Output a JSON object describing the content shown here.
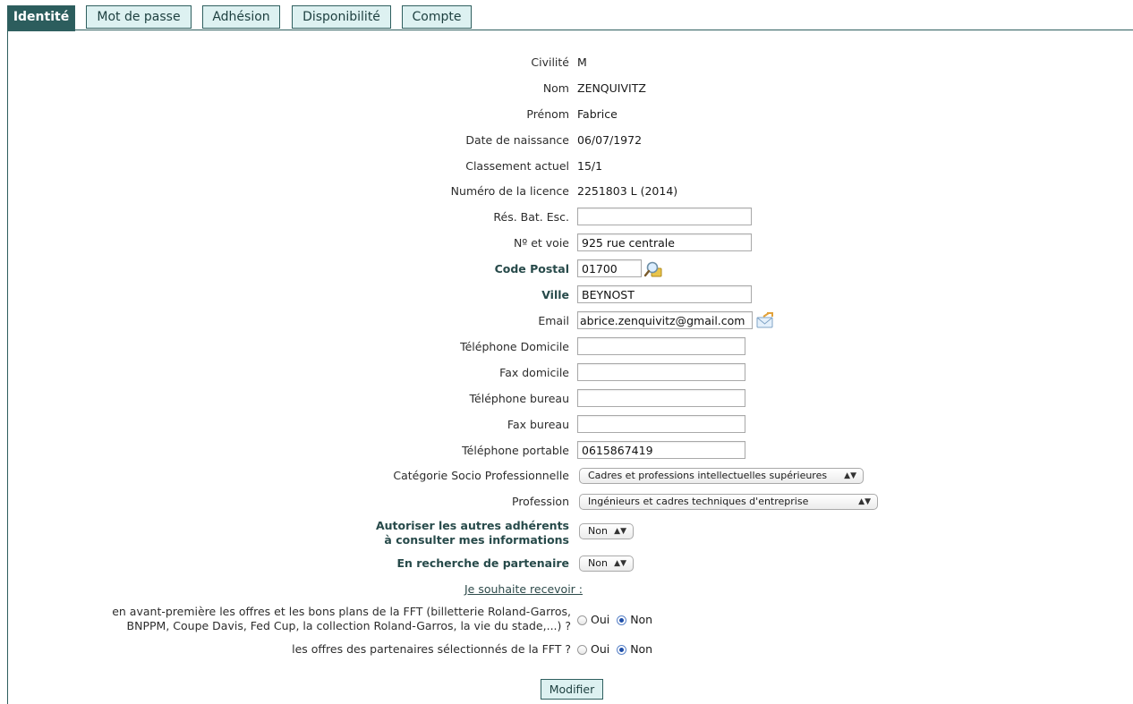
{
  "tabs": [
    "Identité",
    "Mot de passe",
    "Adhésion",
    "Disponibilité",
    "Compte"
  ],
  "fields": {
    "civilite": {
      "label": "Civilité",
      "value": "M"
    },
    "nom": {
      "label": "Nom",
      "value": "ZENQUIVITZ"
    },
    "prenom": {
      "label": "Prénom",
      "value": "Fabrice"
    },
    "naissance": {
      "label": "Date de naissance",
      "value": "06/07/1972"
    },
    "classement": {
      "label": "Classement actuel",
      "value": "15/1"
    },
    "licence": {
      "label": "Numéro de la licence",
      "value": "2251803 L (2014)"
    },
    "res": {
      "label": "Rés. Bat. Esc.",
      "value": ""
    },
    "voie": {
      "label": "Nº et voie",
      "value": "925 rue centrale"
    },
    "cp": {
      "label": "Code Postal",
      "value": "01700"
    },
    "ville": {
      "label": "Ville",
      "value": "BEYNOST"
    },
    "email": {
      "label": "Email",
      "value": "abrice.zenquivitz@gmail.com"
    },
    "tel_dom": {
      "label": "Téléphone Domicile",
      "value": ""
    },
    "fax_dom": {
      "label": "Fax domicile",
      "value": ""
    },
    "tel_bur": {
      "label": "Téléphone bureau",
      "value": ""
    },
    "fax_bur": {
      "label": "Fax bureau",
      "value": ""
    },
    "portable": {
      "label": "Téléphone portable",
      "value": "0615867419"
    },
    "csp": {
      "label": "Catégorie Socio Professionnelle",
      "value": "Cadres et professions intellectuelles supérieures"
    },
    "profession": {
      "label": "Profession",
      "value": "Ingénieurs et cadres techniques d'entreprise"
    },
    "autoriser": {
      "label_line1": "Autoriser les autres adhérents",
      "label_line2": "à consulter mes informations",
      "value": "Non"
    },
    "recherche": {
      "label": "En recherche de partenaire",
      "value": "Non"
    }
  },
  "receive_link": "Je souhaite recevoir :",
  "offers_fft": {
    "label_line1": "en avant-première les offres et les bons plans de la FFT (billetterie Roland-Garros,",
    "label_line2": "BNPPM, Coupe Davis, Fed Cup, la collection Roland-Garros, la vie du stade,...) ?",
    "yes": "Oui",
    "no": "Non",
    "selected": "Non"
  },
  "offers_partners": {
    "label": "les offres des partenaires sélectionnés de la FFT ?",
    "yes": "Oui",
    "no": "Non",
    "selected": "Non"
  },
  "submit": "Modifier",
  "icons": {
    "postal_lookup": "magnifier-icon",
    "email": "envelope-icon"
  },
  "colors": {
    "accent": "#2c5d5d",
    "tab_bg": "#ddf1f1"
  }
}
